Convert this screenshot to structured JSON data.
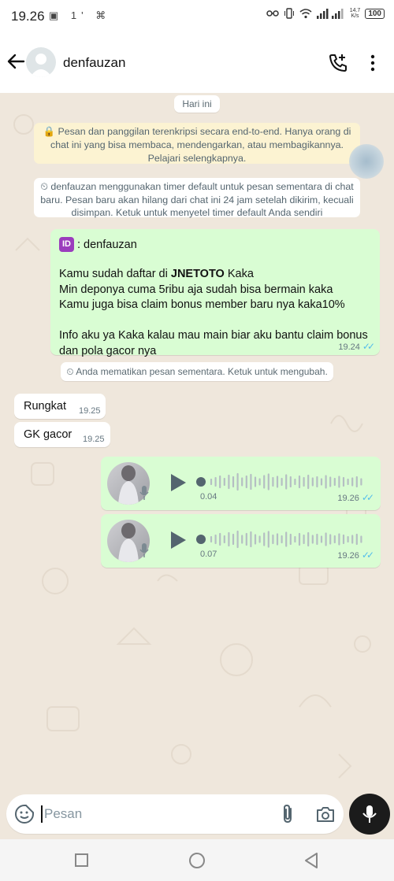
{
  "status_bar": {
    "time": "19.26",
    "left_icons": "▣ 1' ⌘",
    "speed": "14.7\nK/s",
    "battery": "100"
  },
  "header": {
    "contact_name": "denfauzan"
  },
  "chat": {
    "date_chip": "Hari ini",
    "encryption_notice": "🔒 Pesan dan panggilan terenkripsi secara end-to-end. Hanya orang di chat ini yang bisa membaca, mendengarkan, atau membagikannya. Pelajari selengkapnya.",
    "timer_notice": "⏲ denfauzan menggunakan timer default untuk pesan sementara di chat baru. Pesan baru akan hilang dari chat ini 24 jam setelah dikirim, kecuali disimpan. Ketuk untuk menyetel timer default Anda sendiri",
    "main_message": {
      "id_badge": "ID",
      "id_line": ": denfauzan",
      "body_line1_prefix": "Kamu sudah daftar di ",
      "body_line1_bold": "JNETOTO",
      "body_line1_suffix": " Kaka",
      "body_rest": "Min deponya cuma 5ribu aja sudah bisa bermain kaka\nKamu juga bisa claim bonus member baru nya kaka10%\n\nInfo aku ya Kaka kalau mau main biar aku bantu claim bonus dan pola gacor nya",
      "time": "19.24"
    },
    "disappearing_off_notice": "⏲ Anda mematikan pesan sementara. Ketuk untuk mengubah.",
    "incoming": [
      {
        "text": "Rungkat",
        "time": "19.25"
      },
      {
        "text": "GK gacor",
        "time": "19.25"
      }
    ],
    "voice_notes": [
      {
        "duration": "0.04",
        "time": "19.26"
      },
      {
        "duration": "0.07",
        "time": "19.26"
      }
    ]
  },
  "composer": {
    "placeholder": "Pesan"
  },
  "colors": {
    "outgoing_bubble": "#d9fdd3",
    "read_ticks": "#53bdeb",
    "wallpaper": "#efe7dc"
  },
  "icons": [
    "back-arrow-icon",
    "add-call-icon",
    "more-options-icon",
    "emoji-icon",
    "attach-icon",
    "camera-icon",
    "mic-icon",
    "play-icon"
  ]
}
